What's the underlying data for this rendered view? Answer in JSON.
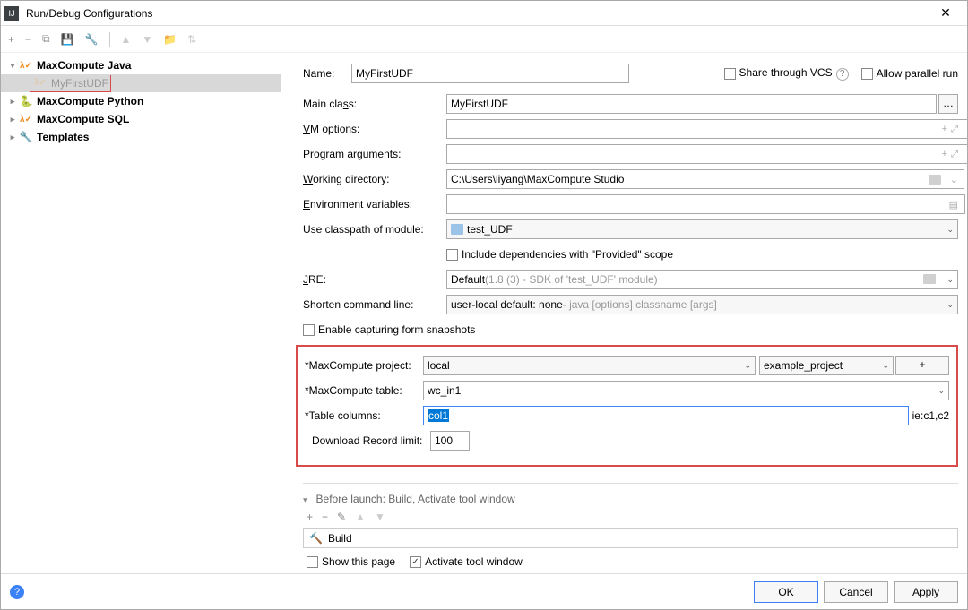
{
  "window": {
    "title": "Run/Debug Configurations"
  },
  "tree": {
    "n0": "MaxCompute Java",
    "n0_child": "MyFirstUDF",
    "n1": "MaxCompute Python",
    "n2": "MaxCompute SQL",
    "n3": "Templates"
  },
  "top": {
    "name_label": "Name:",
    "name_value": "MyFirstUDF",
    "share_label": "Share through VCS",
    "parallel_label": "Allow parallel run"
  },
  "fields": {
    "main_class_label": "Main class:",
    "main_class_value": "MyFirstUDF",
    "vm_label": "VM options:",
    "prog_args_label": "Program arguments:",
    "workdir_label": "Working directory:",
    "workdir_value": "C:\\Users\\liyang\\MaxCompute Studio",
    "env_label": "Environment variables:",
    "classpath_label": "Use classpath of module:",
    "classpath_value": "test_UDF",
    "include_dep_label": "Include dependencies with \"Provided\" scope",
    "jre_label": "JRE:",
    "jre_value": "Default ",
    "jre_hint": "(1.8 (3) - SDK of 'test_UDF' module)",
    "shorten_label": "Shorten command line:",
    "shorten_value": "user-local default: none ",
    "shorten_hint": "- java [options] classname [args]",
    "enable_snap_label": "Enable capturing form snapshots"
  },
  "mc": {
    "project_label": "*MaxCompute project:",
    "project_value": "local",
    "project_value2": "example_project",
    "table_label": "*MaxCompute table:",
    "table_value": "wc_in1",
    "columns_label": "*Table columns:",
    "columns_value": "col1",
    "columns_hint": "ie:c1,c2",
    "download_label": "Download Record limit:",
    "download_value": "100"
  },
  "before": {
    "title": "Before launch: Build, Activate tool window",
    "build": "Build",
    "show_page": "Show this page",
    "activate": "Activate tool window"
  },
  "buttons": {
    "ok": "OK",
    "cancel": "Cancel",
    "apply": "Apply"
  }
}
